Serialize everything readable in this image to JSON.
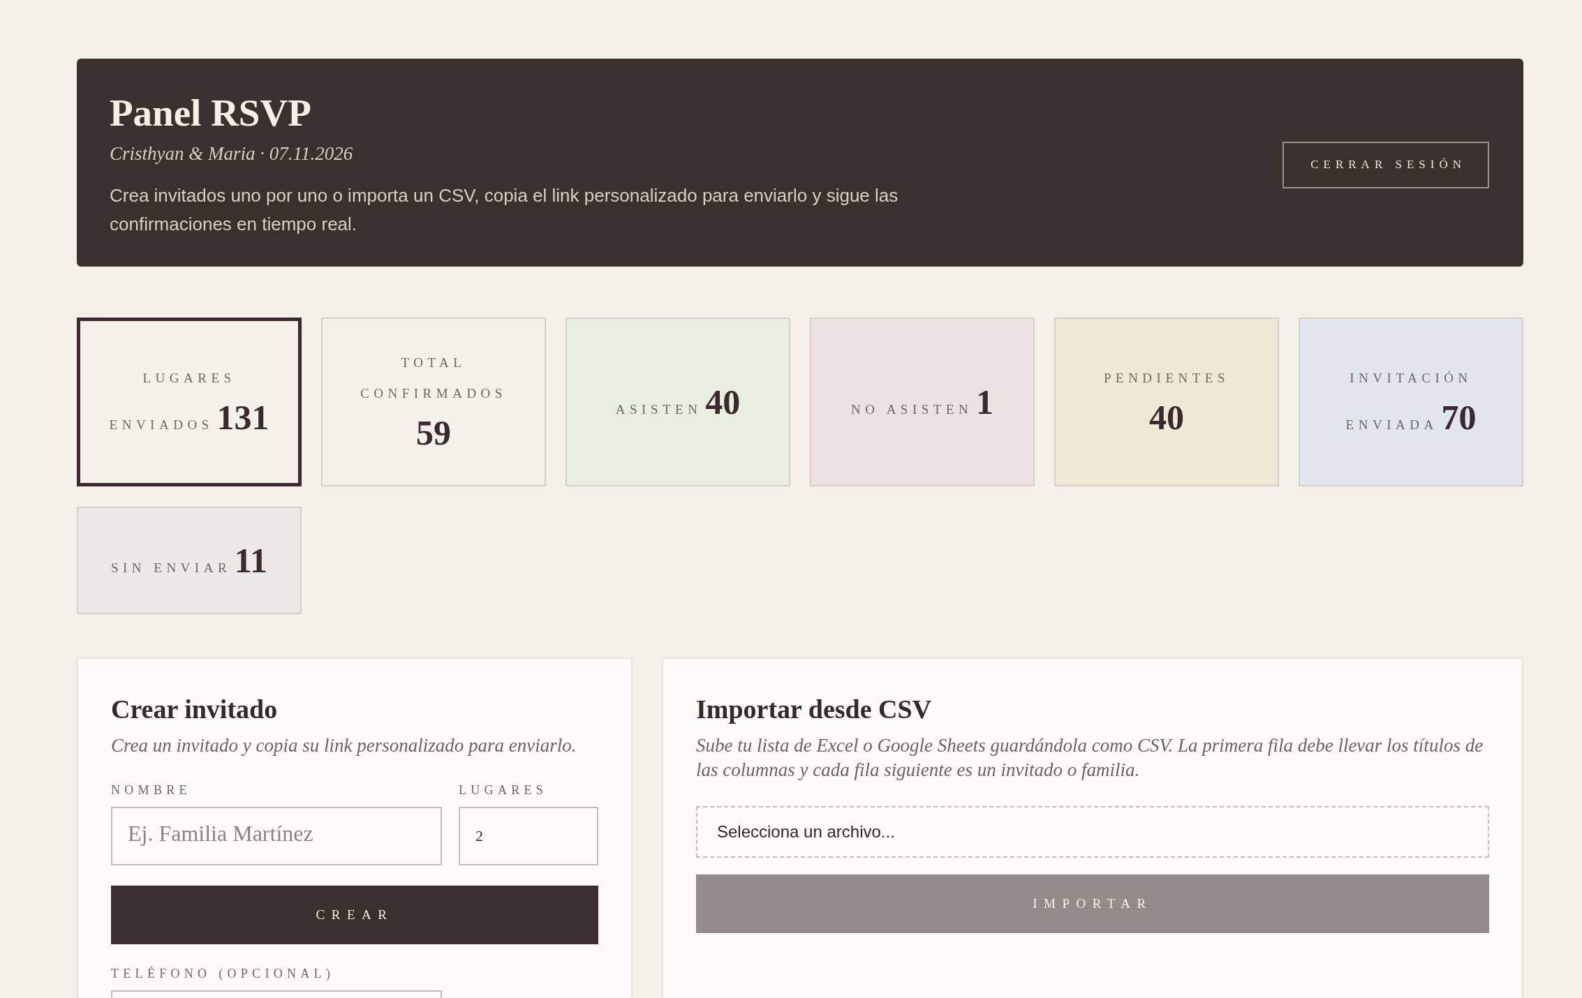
{
  "header": {
    "title": "Panel RSVP",
    "subtitle": "Cristhyan & Maria · 07.11.2026",
    "description": "Crea invitados uno por uno o importa un CSV, copia el link personalizado para enviarlo y sigue las confirmaciones en tiempo real.",
    "logout_button": "CERRAR SESIÓN"
  },
  "stats": [
    {
      "label": "LUGARES ENVIADOS",
      "value": "131",
      "color": "#f4f1ea",
      "selected": true
    },
    {
      "label": "TOTAL CONFIRMADOS",
      "value": "59",
      "color": "#f4f1ea",
      "selected": false
    },
    {
      "label": "ASISTEN",
      "value": "40",
      "color": "#e8eee0",
      "selected": false
    },
    {
      "label": "NO ASISTEN",
      "value": "1",
      "color": "#ede2e2",
      "selected": false
    },
    {
      "label": "PENDIENTES",
      "value": "40",
      "color": "#f0e8d7",
      "selected": false
    },
    {
      "label": "INVITACIÓN ENVIADA",
      "value": "70",
      "color": "#e1e5ee",
      "selected": false
    },
    {
      "label": "SIN ENVIAR",
      "value": "11",
      "color": "#ebe9e5",
      "selected": false
    }
  ],
  "create_guest": {
    "title": "Crear invitado",
    "description": "Crea un invitado y copia su link personalizado para enviarlo.",
    "fields": [
      {
        "label": "NOMBRE",
        "placeholder": "Ej. Familia Martínez"
      },
      {
        "label": "LUGARES",
        "value": "2"
      }
    ],
    "button": {
      "label": "CREAR",
      "disabled": false
    },
    "phone_field": {
      "label": "TELÉFONO (OPCIONAL)"
    }
  },
  "import_csv": {
    "title": "Importar desde CSV",
    "description": "Sube tu lista de Excel o Google Sheets guardándola como CSV. La primera fila debe llevar los títulos de las columnas y cada fila siguiente es un invitado o familia.",
    "file_field": {
      "text": "Selecciona un archivo..."
    },
    "button": {
      "label": "IMPORTAR",
      "disabled": true
    }
  }
}
